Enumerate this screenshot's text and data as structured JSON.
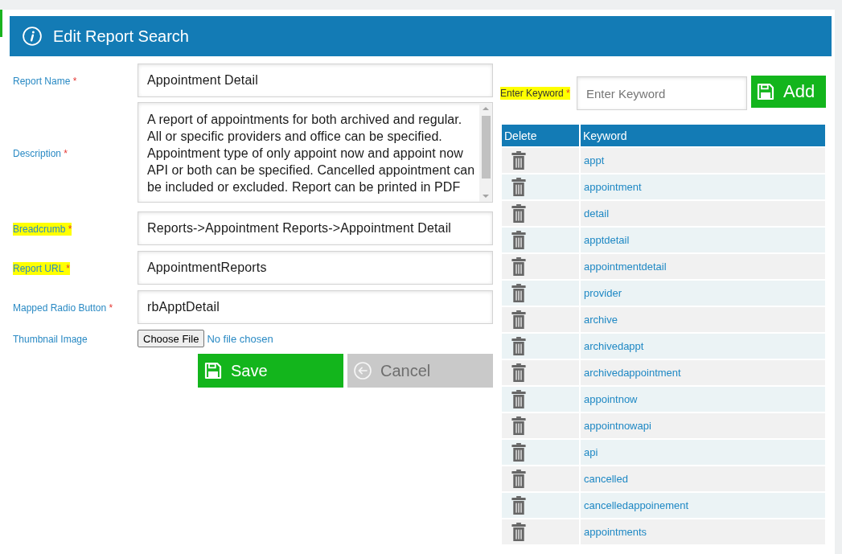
{
  "header": {
    "title": "Edit Report Search"
  },
  "form": {
    "fields": [
      {
        "kind": "text",
        "label": "Report Name",
        "required_mark": "*",
        "highlighted": false,
        "value": "Appointment Detail"
      },
      {
        "kind": "textarea",
        "label": "Description",
        "required_mark": "*",
        "highlighted": false,
        "value": "A report of appointments for both archived and regular. All or specific providers and office can be specified. Appointment type of only appoint now and appoint now API or both can be specified. Cancelled appointment can be included or excluded. Report can be printed in PDF"
      },
      {
        "kind": "text",
        "label": "Breadcrumb",
        "required_mark": "*",
        "highlighted": true,
        "value": "Reports->Appointment Reports->Appointment Detail"
      },
      {
        "kind": "text",
        "label": "Report URL",
        "required_mark": "*",
        "highlighted": true,
        "value": "AppointmentReports"
      },
      {
        "kind": "text",
        "label": "Mapped Radio Button",
        "required_mark": "*",
        "highlighted": false,
        "value": "rbApptDetail"
      },
      {
        "kind": "file",
        "label": "Thumbnail Image",
        "highlighted": false,
        "button": "Choose File",
        "status": "No file chosen"
      }
    ],
    "actions": [
      {
        "kind": "save",
        "label": "Save",
        "disabled": false
      },
      {
        "kind": "cancel",
        "label": "Cancel",
        "disabled": true
      }
    ]
  },
  "keywords": {
    "input": {
      "label": "Enter Keyword",
      "required_mark": "*",
      "highlighted": true,
      "placeholder": "Enter Keyword"
    },
    "add_button": {
      "label": "Add"
    },
    "table": {
      "columns": [
        "Delete",
        "Keyword"
      ],
      "rows": [
        {
          "keyword": "appt"
        },
        {
          "keyword": "appointment"
        },
        {
          "keyword": "detail"
        },
        {
          "keyword": "apptdetail"
        },
        {
          "keyword": "appointmentdetail"
        },
        {
          "keyword": "provider"
        },
        {
          "keyword": "archive"
        },
        {
          "keyword": "archivedappt"
        },
        {
          "keyword": "archivedappointment"
        },
        {
          "keyword": "appointnow"
        },
        {
          "keyword": "appointnowapi"
        },
        {
          "keyword": "api"
        },
        {
          "keyword": "cancelled"
        },
        {
          "keyword": "cancelledappoinement"
        },
        {
          "keyword": "appointments"
        }
      ]
    }
  }
}
